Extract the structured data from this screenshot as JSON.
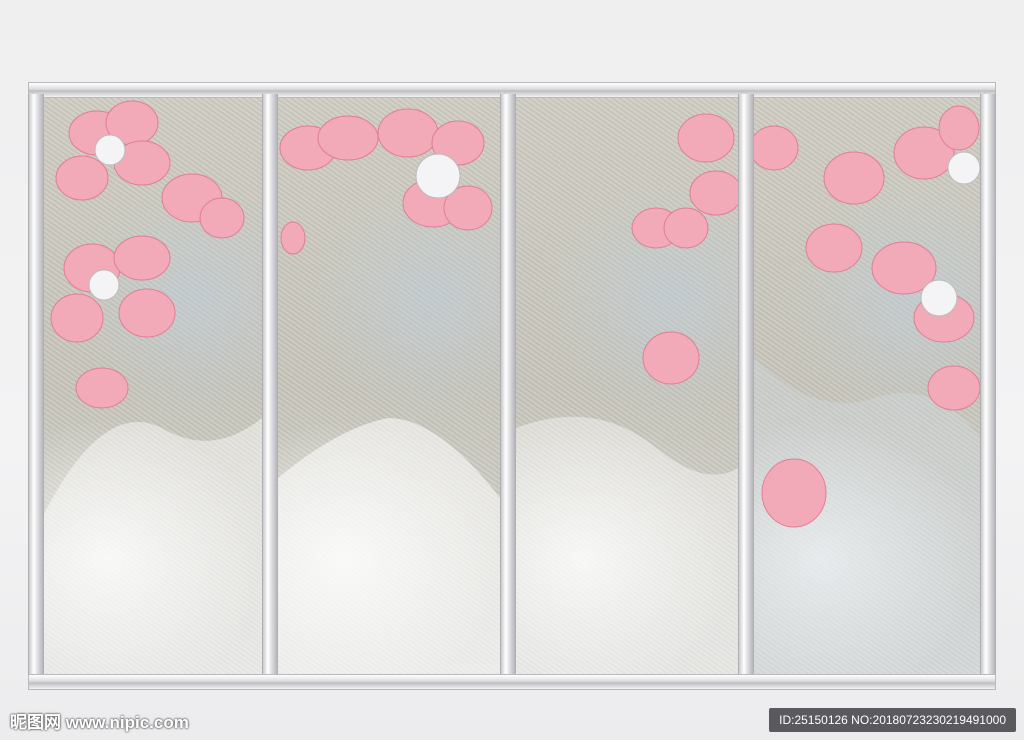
{
  "watermark": {
    "site": "昵图网 www.nipic.com",
    "id_text": "ID:25150126 NO:20180723230219491000"
  },
  "colors": {
    "petal": "#f2a9b8",
    "petal_dark": "#e07e95",
    "pearl": "#f4f4f6",
    "frame": "#dcdce0",
    "panel_bg": "#c9c7bc"
  },
  "artwork": {
    "panel_count": 4,
    "motif": [
      "pink-blossom",
      "pearl",
      "silver-frame"
    ]
  }
}
